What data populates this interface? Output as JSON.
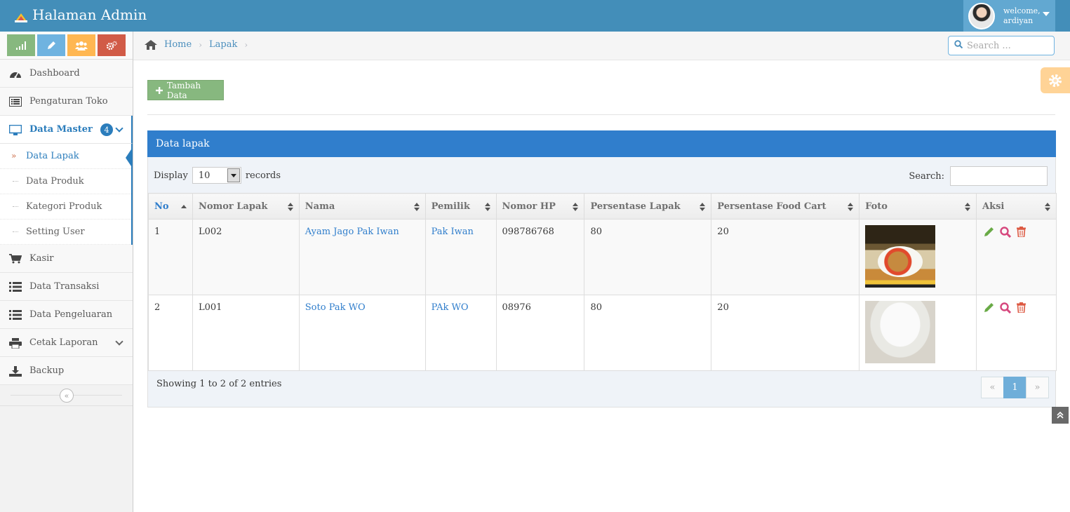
{
  "app": {
    "title": "Halaman Admin",
    "welcome": "welcome,",
    "username": "ardiyan"
  },
  "colors": {
    "navbar": "#438eb9",
    "accent": "#307ecc",
    "success": "#87b87f",
    "warning": "#ffb752",
    "danger": "#d15b47"
  },
  "shortcuts": [
    {
      "icon": "signal-icon",
      "color": "#87b87f"
    },
    {
      "icon": "pencil-icon",
      "color": "#6fb3e0"
    },
    {
      "icon": "users-icon",
      "color": "#ffb752"
    },
    {
      "icon": "cogs-icon",
      "color": "#d15b47"
    }
  ],
  "sidebar": {
    "items": [
      {
        "label": "Dashboard",
        "icon": "tachometer-icon"
      },
      {
        "label": "Pengaturan Toko",
        "icon": "list-alt-icon"
      },
      {
        "label": "Data Master",
        "icon": "desktop-icon",
        "badge": "4",
        "active": true
      },
      {
        "label": "Kasir",
        "icon": "shopping-cart-icon"
      },
      {
        "label": "Data Transaksi",
        "icon": "list-icon"
      },
      {
        "label": "Data Pengeluaran",
        "icon": "list-icon"
      },
      {
        "label": "Cetak Laporan",
        "icon": "print-icon"
      },
      {
        "label": "Backup",
        "icon": "download-icon"
      }
    ],
    "submenu": [
      "Data Lapak",
      "Data Produk",
      "Kategori Produk",
      "Setting User"
    ]
  },
  "breadcrumb": {
    "items": [
      "Home",
      "Lapak"
    ]
  },
  "search": {
    "placeholder": "Search ..."
  },
  "actions": {
    "add_label": "Tambah Data"
  },
  "table": {
    "title": "Data lapak",
    "display_label": "Display",
    "display_value": "10",
    "records_label": "records",
    "search_label": "Search:",
    "columns": [
      "No",
      "Nomor Lapak",
      "Nama",
      "Pemilik",
      "Nomor HP",
      "Persentase Lapak",
      "Persentase Food Cart",
      "Foto",
      "Aksi"
    ],
    "rows": [
      {
        "no": "1",
        "nomor_lapak": "L002",
        "nama": "Ayam Jago Pak Iwan",
        "pemilik": "Pak Iwan",
        "nomor_hp": "098786768",
        "persen_lapak": "80",
        "persen_food_cart": "20"
      },
      {
        "no": "2",
        "nomor_lapak": "L001",
        "nama": "Soto Pak WO",
        "pemilik": "PAk WO",
        "nomor_hp": "08976",
        "persen_lapak": "80",
        "persen_food_cart": "20"
      }
    ],
    "info": "Showing 1 to 2 of 2 entries",
    "pagination": {
      "prev": "«",
      "current": "1",
      "next": "»"
    }
  }
}
